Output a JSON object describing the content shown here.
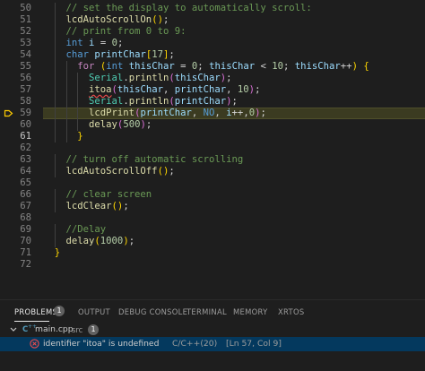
{
  "editor": {
    "lines": [
      {
        "n": "50",
        "tokens": [
          [
            "    ",
            "plain"
          ],
          [
            "// set the display to automatically scroll:",
            "comment"
          ]
        ]
      },
      {
        "n": "51",
        "tokens": [
          [
            "    ",
            "plain"
          ],
          [
            "lcdAutoScrollOn",
            "fn"
          ],
          [
            "()",
            "brk1"
          ],
          [
            ";",
            "plain"
          ]
        ]
      },
      {
        "n": "52",
        "tokens": [
          [
            "    ",
            "plain"
          ],
          [
            "// print from 0 to 9:",
            "comment"
          ]
        ]
      },
      {
        "n": "53",
        "tokens": [
          [
            "    ",
            "plain"
          ],
          [
            "int",
            "kw"
          ],
          [
            " ",
            "plain"
          ],
          [
            "i",
            "var"
          ],
          [
            " = ",
            "plain"
          ],
          [
            "0",
            "num"
          ],
          [
            ";",
            "plain"
          ]
        ]
      },
      {
        "n": "54",
        "tokens": [
          [
            "    ",
            "plain"
          ],
          [
            "char",
            "kw"
          ],
          [
            " ",
            "plain"
          ],
          [
            "printChar",
            "var"
          ],
          [
            "[",
            "brk1"
          ],
          [
            "17",
            "num"
          ],
          [
            "]",
            "brk1"
          ],
          [
            ";",
            "plain"
          ]
        ]
      },
      {
        "n": "55",
        "tokens": [
          [
            "      ",
            "plain"
          ],
          [
            "for",
            "ctrl"
          ],
          [
            " ",
            "plain"
          ],
          [
            "(",
            "brk1"
          ],
          [
            "int",
            "kw"
          ],
          [
            " ",
            "plain"
          ],
          [
            "thisChar",
            "var"
          ],
          [
            " = ",
            "plain"
          ],
          [
            "0",
            "num"
          ],
          [
            "; ",
            "plain"
          ],
          [
            "thisChar",
            "var"
          ],
          [
            " < ",
            "plain"
          ],
          [
            "10",
            "num"
          ],
          [
            "; ",
            "plain"
          ],
          [
            "thisChar",
            "var"
          ],
          [
            "++",
            "plain"
          ],
          [
            ")",
            "brk1"
          ],
          [
            " ",
            "plain"
          ],
          [
            "{",
            "brk1"
          ]
        ]
      },
      {
        "n": "56",
        "tokens": [
          [
            "        ",
            "plain"
          ],
          [
            "Serial",
            "class"
          ],
          [
            ".",
            "plain"
          ],
          [
            "println",
            "fn"
          ],
          [
            "(",
            "brk2"
          ],
          [
            "thisChar",
            "var"
          ],
          [
            ")",
            "brk2"
          ],
          [
            ";",
            "plain"
          ]
        ]
      },
      {
        "n": "57",
        "tokens": [
          [
            "        ",
            "plain"
          ],
          [
            "itoa",
            "fn squiggle"
          ],
          [
            "(",
            "brk2"
          ],
          [
            "thisChar",
            "var"
          ],
          [
            ", ",
            "plain"
          ],
          [
            "printChar",
            "var"
          ],
          [
            ", ",
            "plain"
          ],
          [
            "10",
            "num"
          ],
          [
            ")",
            "brk2"
          ],
          [
            ";",
            "plain"
          ]
        ]
      },
      {
        "n": "58",
        "tokens": [
          [
            "        ",
            "plain"
          ],
          [
            "Serial",
            "class"
          ],
          [
            ".",
            "plain"
          ],
          [
            "println",
            "fn"
          ],
          [
            "(",
            "brk2"
          ],
          [
            "printChar",
            "var"
          ],
          [
            ")",
            "brk2"
          ],
          [
            ";",
            "plain"
          ]
        ]
      },
      {
        "n": "59",
        "tokens": [
          [
            "        ",
            "plain"
          ],
          [
            "lcdPrint",
            "fn"
          ],
          [
            "(",
            "brk2"
          ],
          [
            "printChar",
            "var"
          ],
          [
            ", ",
            "plain"
          ],
          [
            "NO",
            "macro"
          ],
          [
            ", ",
            "plain"
          ],
          [
            "i",
            "var"
          ],
          [
            "++",
            "plain"
          ],
          [
            ",",
            "plain"
          ],
          [
            "0",
            "num"
          ],
          [
            ")",
            "brk2"
          ],
          [
            ";",
            "plain"
          ]
        ]
      },
      {
        "n": "60",
        "tokens": [
          [
            "        ",
            "plain"
          ],
          [
            "delay",
            "fn"
          ],
          [
            "(",
            "brk2"
          ],
          [
            "500",
            "num"
          ],
          [
            ")",
            "brk2"
          ],
          [
            ";",
            "plain"
          ]
        ]
      },
      {
        "n": "61",
        "tokens": [
          [
            "      ",
            "plain"
          ],
          [
            "}",
            "brk1"
          ]
        ]
      },
      {
        "n": "62",
        "tokens": []
      },
      {
        "n": "63",
        "tokens": [
          [
            "    ",
            "plain"
          ],
          [
            "// turn off automatic scrolling",
            "comment"
          ]
        ]
      },
      {
        "n": "64",
        "tokens": [
          [
            "    ",
            "plain"
          ],
          [
            "lcdAutoScrollOff",
            "fn"
          ],
          [
            "()",
            "brk1"
          ],
          [
            ";",
            "plain"
          ]
        ]
      },
      {
        "n": "65",
        "tokens": []
      },
      {
        "n": "66",
        "tokens": [
          [
            "    ",
            "plain"
          ],
          [
            "// clear screen",
            "comment"
          ]
        ]
      },
      {
        "n": "67",
        "tokens": [
          [
            "    ",
            "plain"
          ],
          [
            "lcdClear",
            "fn"
          ],
          [
            "()",
            "brk1"
          ],
          [
            ";",
            "plain"
          ]
        ]
      },
      {
        "n": "68",
        "tokens": []
      },
      {
        "n": "69",
        "tokens": [
          [
            "    ",
            "plain"
          ],
          [
            "//Delay",
            "comment"
          ]
        ]
      },
      {
        "n": "70",
        "tokens": [
          [
            "    ",
            "plain"
          ],
          [
            "delay",
            "fn"
          ],
          [
            "(",
            "brk1"
          ],
          [
            "1000",
            "num"
          ],
          [
            ")",
            "brk1"
          ],
          [
            ";",
            "plain"
          ]
        ]
      },
      {
        "n": "71",
        "tokens": [
          [
            "  ",
            "plain"
          ],
          [
            "}",
            "brk1"
          ]
        ]
      },
      {
        "n": "72",
        "tokens": []
      }
    ],
    "highlighted_line": "59",
    "active_line": "61"
  },
  "panel": {
    "tabs": [
      {
        "label": "PROBLEMS",
        "badge": "1",
        "active": true
      },
      {
        "label": "OUTPUT",
        "active": false
      },
      {
        "label": "DEBUG CONSOLE",
        "active": false
      },
      {
        "label": "TERMINAL",
        "active": false
      },
      {
        "label": "MEMORY",
        "active": false
      },
      {
        "label": "XRTOS",
        "active": false
      }
    ],
    "file_group": {
      "filename": "main.cpp",
      "folder": "src",
      "count": "1"
    },
    "problem": {
      "message": "identifier \"itoa\" is undefined",
      "source": "C/C++(20)",
      "location": "[Ln 57, Col 9]"
    }
  },
  "colors": {
    "error": "#f14c4c",
    "highlight_bg": "#3b3b21",
    "selection": "#04395e"
  }
}
